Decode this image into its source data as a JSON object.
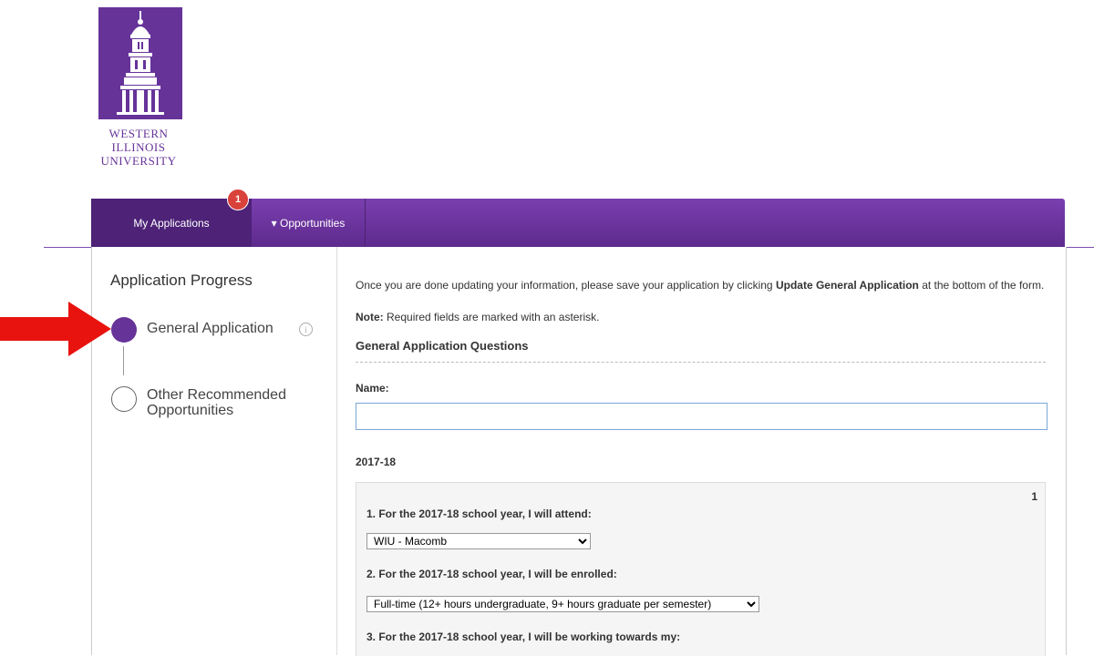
{
  "logo": {
    "line1": "WESTERN",
    "line2": "ILLINOIS",
    "line3": "UNIVERSITY"
  },
  "nav": {
    "tabs": [
      {
        "label": "My Applications",
        "active": true
      },
      {
        "label": "▾ Opportunities",
        "active": false
      }
    ],
    "badge_count": "1"
  },
  "sidebar": {
    "title": "Application Progress",
    "steps": [
      {
        "label": "General Application",
        "complete": true
      },
      {
        "label": "Other Recommended Opportunities",
        "complete": false
      }
    ]
  },
  "form": {
    "intro_pre": "Once you are done updating your information, please save your application by clicking ",
    "intro_bold": "Update General Application",
    "intro_post": " at the bottom of the form.",
    "note_label": "Note:",
    "note_text": " Required fields are marked with an asterisk.",
    "section_title": "General Application Questions",
    "name_label": "Name:",
    "name_value": "",
    "year_label": "2017-18",
    "question_box_number": "1",
    "q1": "1. For the 2017-18 school year, I will attend:",
    "q1_selected": "WIU - Macomb",
    "q2": "2. For the 2017-18 school year, I will be enrolled:",
    "q2_selected": "Full-time (12+ hours undergraduate, 9+ hours graduate per semester)",
    "q3": "3. For the 2017-18 school year, I will be working towards my:"
  },
  "colors": {
    "brand_purple": "#663399",
    "badge_red": "#d9413b",
    "arrow_red": "#e8130f"
  }
}
